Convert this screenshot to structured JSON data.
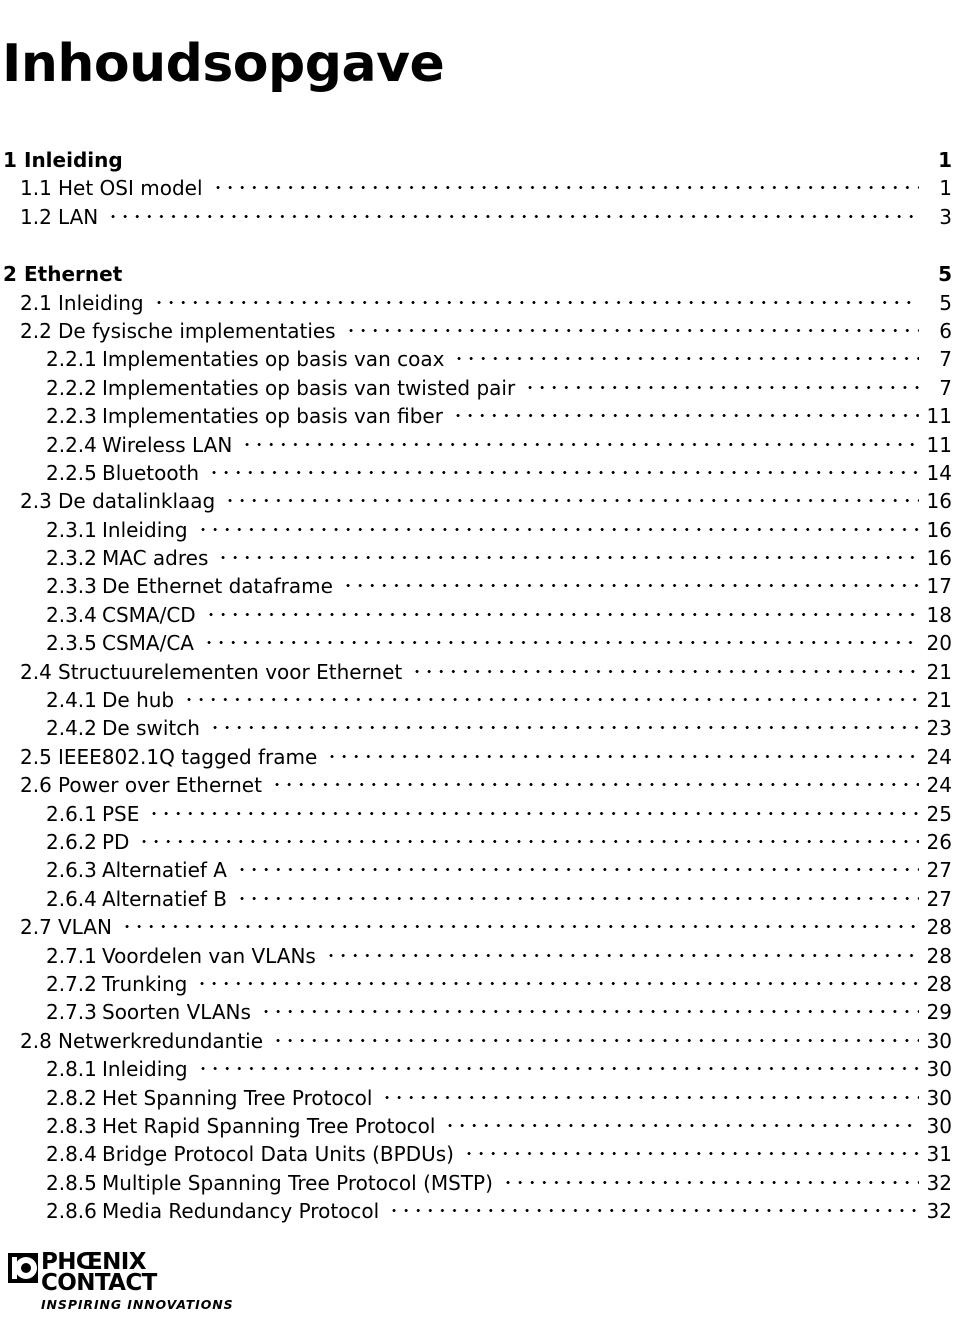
{
  "document": {
    "title": "Inhoudsopgave"
  },
  "toc": {
    "entries": [
      {
        "level": 1,
        "number": "1",
        "label": "Inleiding",
        "page": "1",
        "spaced": false
      },
      {
        "level": 2,
        "number": "1.1",
        "label": "Het OSI model",
        "page": "1",
        "spaced": false
      },
      {
        "level": 2,
        "number": "1.2",
        "label": "LAN",
        "page": "3",
        "spaced": false
      },
      {
        "level": 1,
        "number": "2",
        "label": "Ethernet",
        "page": "5",
        "spaced": true
      },
      {
        "level": 2,
        "number": "2.1",
        "label": "Inleiding",
        "page": "5",
        "spaced": false
      },
      {
        "level": 2,
        "number": "2.2",
        "label": "De fysische implementaties",
        "page": "6",
        "spaced": false
      },
      {
        "level": 3,
        "number": "2.2.1",
        "label": "Implementaties op basis van coax",
        "page": "7",
        "spaced": false
      },
      {
        "level": 3,
        "number": "2.2.2",
        "label": "Implementaties op basis van twisted pair",
        "page": "7",
        "spaced": false
      },
      {
        "level": 3,
        "number": "2.2.3",
        "label": "Implementaties op basis van fiber",
        "page": "11",
        "spaced": false
      },
      {
        "level": 3,
        "number": "2.2.4",
        "label": "Wireless LAN",
        "page": "11",
        "spaced": false
      },
      {
        "level": 3,
        "number": "2.2.5",
        "label": "Bluetooth",
        "page": "14",
        "spaced": false
      },
      {
        "level": 2,
        "number": "2.3",
        "label": "De datalinklaag",
        "page": "16",
        "spaced": false
      },
      {
        "level": 3,
        "number": "2.3.1",
        "label": "Inleiding",
        "page": "16",
        "spaced": false
      },
      {
        "level": 3,
        "number": "2.3.2",
        "label": "MAC adres",
        "page": "16",
        "spaced": false
      },
      {
        "level": 3,
        "number": "2.3.3",
        "label": "De Ethernet dataframe",
        "page": "17",
        "spaced": false
      },
      {
        "level": 3,
        "number": "2.3.4",
        "label": "CSMA/CD",
        "page": "18",
        "spaced": false
      },
      {
        "level": 3,
        "number": "2.3.5",
        "label": "CSMA/CA",
        "page": "20",
        "spaced": false
      },
      {
        "level": 2,
        "number": "2.4",
        "label": "Structuurelementen voor Ethernet",
        "page": "21",
        "spaced": false
      },
      {
        "level": 3,
        "number": "2.4.1",
        "label": "De hub",
        "page": "21",
        "spaced": false
      },
      {
        "level": 3,
        "number": "2.4.2",
        "label": "De switch",
        "page": "23",
        "spaced": false
      },
      {
        "level": 2,
        "number": "2.5",
        "label": "IEEE802.1Q tagged frame",
        "page": "24",
        "spaced": false
      },
      {
        "level": 2,
        "number": "2.6",
        "label": "Power over Ethernet",
        "page": "24",
        "spaced": false
      },
      {
        "level": 3,
        "number": "2.6.1",
        "label": "PSE",
        "page": "25",
        "spaced": false
      },
      {
        "level": 3,
        "number": "2.6.2",
        "label": "PD",
        "page": "26",
        "spaced": false
      },
      {
        "level": 3,
        "number": "2.6.3",
        "label": "Alternatief A",
        "page": "27",
        "spaced": false
      },
      {
        "level": 3,
        "number": "2.6.4",
        "label": "Alternatief B",
        "page": "27",
        "spaced": false
      },
      {
        "level": 2,
        "number": "2.7",
        "label": "VLAN",
        "page": "28",
        "spaced": false
      },
      {
        "level": 3,
        "number": "2.7.1",
        "label": "Voordelen van VLANs",
        "page": "28",
        "spaced": false
      },
      {
        "level": 3,
        "number": "2.7.2",
        "label": "Trunking",
        "page": "28",
        "spaced": false
      },
      {
        "level": 3,
        "number": "2.7.3",
        "label": "Soorten VLANs",
        "page": "29",
        "spaced": false
      },
      {
        "level": 2,
        "number": "2.8",
        "label": "Netwerkredundantie",
        "page": "30",
        "spaced": false
      },
      {
        "level": 3,
        "number": "2.8.1",
        "label": "Inleiding",
        "page": "30",
        "spaced": false
      },
      {
        "level": 3,
        "number": "2.8.2",
        "label": "Het Spanning Tree Protocol",
        "page": "30",
        "spaced": false
      },
      {
        "level": 3,
        "number": "2.8.3",
        "label": "Het Rapid Spanning Tree Protocol",
        "page": "30",
        "spaced": false
      },
      {
        "level": 3,
        "number": "2.8.4",
        "label": "Bridge Protocol Data Units (BPDUs)",
        "page": "31",
        "spaced": false
      },
      {
        "level": 3,
        "number": "2.8.5",
        "label": "Multiple Spanning Tree Protocol (MSTP)",
        "page": "32",
        "spaced": false
      },
      {
        "level": 3,
        "number": "2.8.6",
        "label": "Media Redundancy Protocol",
        "page": "32",
        "spaced": false
      }
    ]
  },
  "footer": {
    "logo": {
      "line1": "PHŒNIX",
      "line2": "CONTACT",
      "tagline": "INSPIRING INNOVATIONS"
    }
  }
}
